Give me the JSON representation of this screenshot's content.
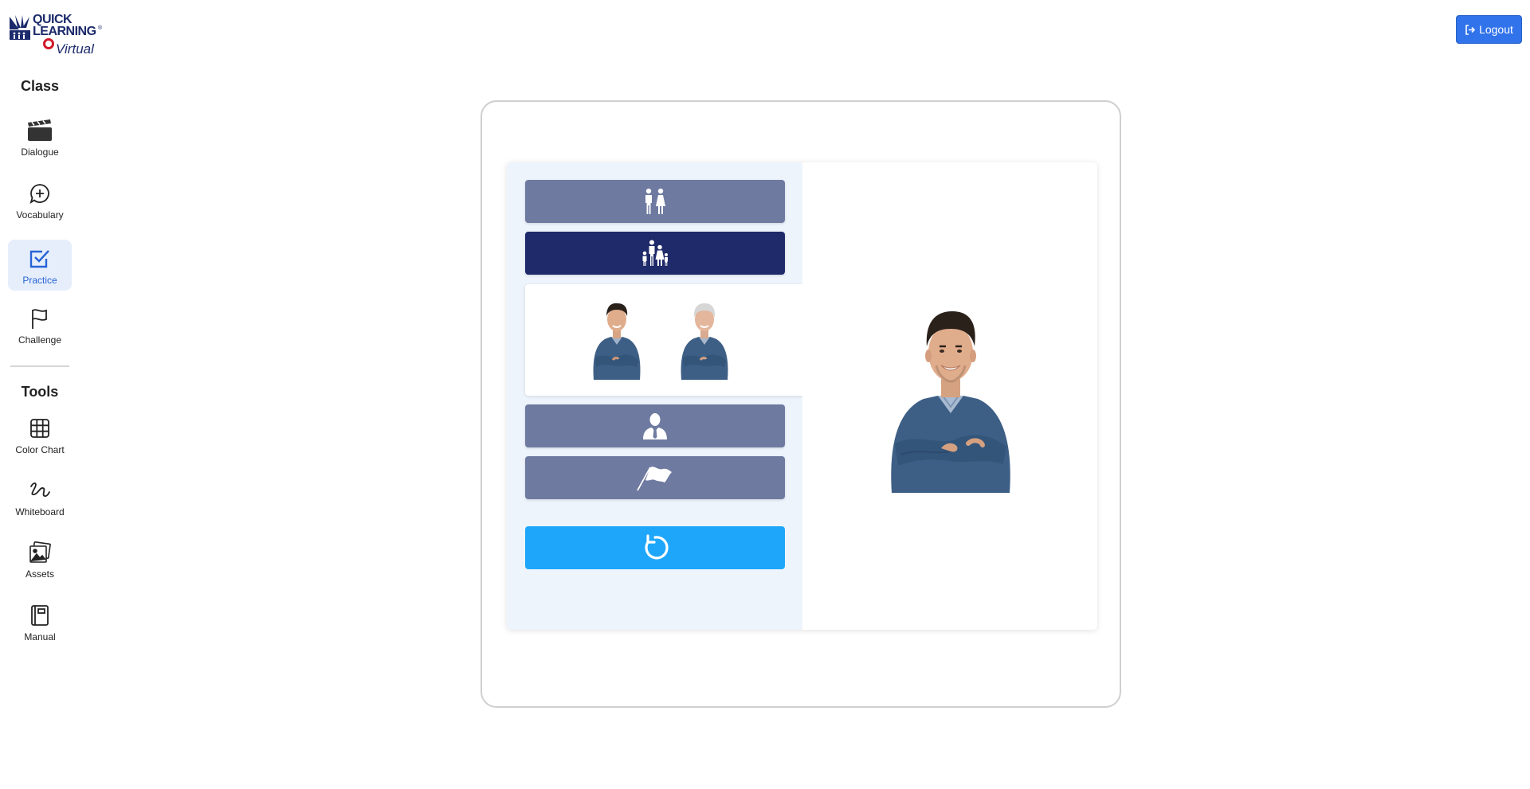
{
  "logo": {
    "line1": "QUICK",
    "line2": "LEARNING",
    "line3": "Virtual",
    "registered": "®",
    "logo_icon": "quick-learning-logo"
  },
  "sidebar": {
    "class_title": "Class",
    "tools_title": "Tools",
    "class_items": [
      {
        "label": "Dialogue",
        "icon": "clapperboard-icon"
      },
      {
        "label": "Vocabulary",
        "icon": "chat-plus-icon"
      },
      {
        "label": "Practice",
        "icon": "checkbox-icon",
        "active": true
      },
      {
        "label": "Challenge",
        "icon": "flag-icon"
      }
    ],
    "tool_items": [
      {
        "label": "Color Chart",
        "icon": "grid-icon"
      },
      {
        "label": "Whiteboard",
        "icon": "scribble-icon"
      },
      {
        "label": "Assets",
        "icon": "images-icon"
      },
      {
        "label": "Manual",
        "icon": "notebook-icon"
      }
    ]
  },
  "header": {
    "logout_label": "Logout",
    "logout_icon": "sign-out-icon"
  },
  "exercise": {
    "options": [
      {
        "icon": "couple-icon",
        "selected": false
      },
      {
        "icon": "family-icon",
        "selected": true
      },
      {
        "icon": "businessman-icon",
        "selected": false
      },
      {
        "icon": "waving-flag-icon",
        "selected": false
      }
    ],
    "expanded_images": [
      "young-man-image",
      "older-man-image"
    ],
    "reset_icon": "reset-arrow-icon",
    "display_image": "young-man-image"
  },
  "colors": {
    "primary": "#3173ea",
    "option": "#6e7aa0",
    "option_selected": "#1f2a6a",
    "reset": "#1ea7fa",
    "active_nav_bg": "#e6eefc",
    "active_nav_text": "#2763d6",
    "logo_navy": "#1b2a6b",
    "logo_red": "#d0182a"
  }
}
